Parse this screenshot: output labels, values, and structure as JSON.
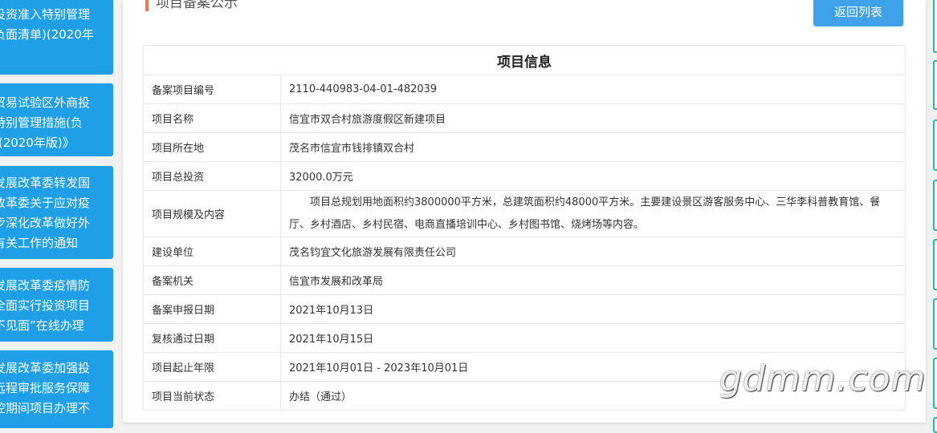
{
  "sidebar": {
    "items": [
      {
        "text": "投资准入特别管理\n负面清单)(2020年"
      },
      {
        "text": "贸易试验区外商投\n特别管理措施(负\n)(2020年版)》"
      },
      {
        "text": "发展改革委转发国\n改革委关于应对疫\n步深化改革做好外\n有关工作的通知"
      },
      {
        "text": "发展改革委疫情防\n全面实行投资项目\n不见面”在线办理"
      },
      {
        "text": "发展改革委加强投\n远程审批服务保障\n控期间项目办理不"
      }
    ]
  },
  "header": {
    "title": "项目备案公示",
    "back_label": "返回列表"
  },
  "table": {
    "title": "项目信息",
    "rows": [
      {
        "label": "备案项目编号",
        "value": "2110-440983-04-01-482039"
      },
      {
        "label": "项目名称",
        "value": "信宜市双合村旅游度假区新建项目"
      },
      {
        "label": "项目所在地",
        "value": "茂名市信宜市钱排镇双合村"
      },
      {
        "label": "项目总投资",
        "value": "32000.0万元"
      },
      {
        "label": "项目规模及内容",
        "value": "项目总规划用地面积约3800000平方米，总建筑面积约48000平方米。主要建设景区游客服务中心、三华李科普教育馆、餐厅、乡村酒店、乡村民宿、电商直播培训中心、乡村图书馆、烧烤场等内容。"
      },
      {
        "label": "建设单位",
        "value": "茂名钧宜文化旅游发展有限责任公司"
      },
      {
        "label": "备案机关",
        "value": "信宜市发展和改革局"
      },
      {
        "label": "备案申报日期",
        "value": "2021年10月13日"
      },
      {
        "label": "复核通过日期",
        "value": "2021年10月15日"
      },
      {
        "label": "项目起止年限",
        "value": "2021年10月01日 - 2023年10月01日"
      },
      {
        "label": "项目当前状态",
        "value": "办结（通过）"
      }
    ]
  },
  "watermark": "gdmm.com",
  "colors": {
    "accent": "#1e9fe7",
    "button": "#3fa2e8",
    "title_bar": "#e97a55",
    "right_tabs": "#28b9a8"
  }
}
